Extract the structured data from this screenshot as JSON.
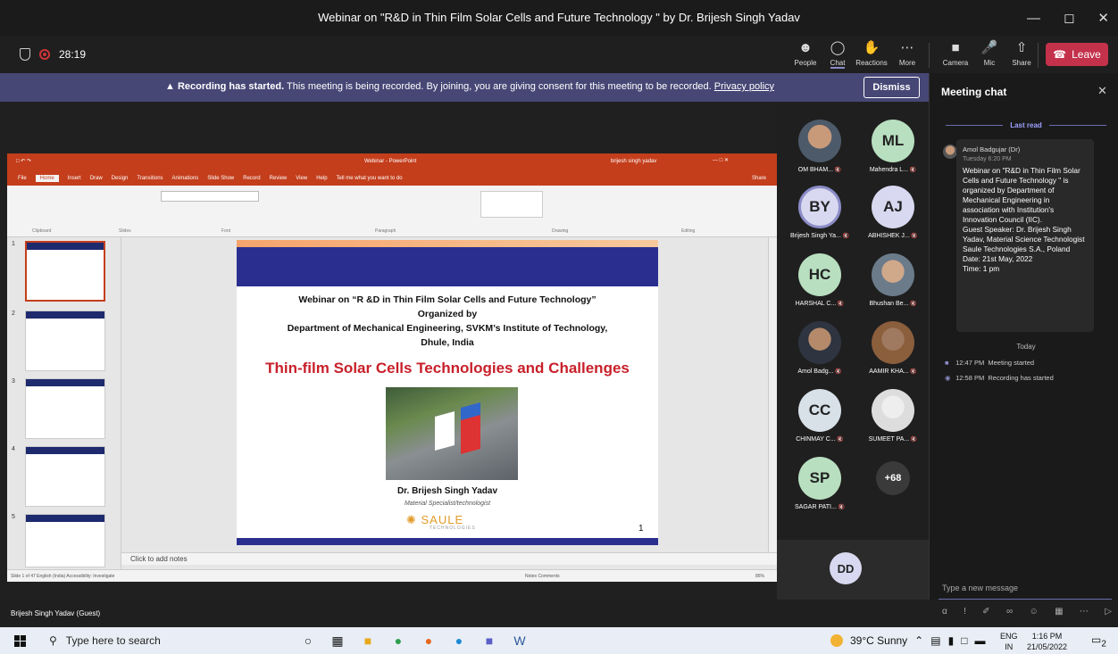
{
  "window": {
    "title": "Webinar on \"R&D in Thin Film Solar Cells and Future Technology \" by Dr. Brijesh Singh Yadav"
  },
  "meeting": {
    "timer": "28:19",
    "controls": [
      {
        "label": "People",
        "icon": "people-icon"
      },
      {
        "label": "Chat",
        "icon": "chat-icon"
      },
      {
        "label": "Reactions",
        "icon": "reactions-icon"
      },
      {
        "label": "More",
        "icon": "more-icon"
      },
      {
        "label": "Camera",
        "icon": "camera-off-icon"
      },
      {
        "label": "Mic",
        "icon": "mic-off-icon"
      },
      {
        "label": "Share",
        "icon": "share-icon"
      }
    ],
    "leave_label": "Leave"
  },
  "banner": {
    "title": "Recording has started.",
    "message": "This meeting is being recorded. By joining, you are giving consent for this meeting to be recorded.",
    "link": "Privacy policy",
    "dismiss": "Dismiss"
  },
  "ppt": {
    "title": "Webinar - PowerPoint",
    "user": "brijesh singh yadav",
    "tabs": [
      "File",
      "Home",
      "Insert",
      "Draw",
      "Design",
      "Transitions",
      "Animations",
      "Slide Show",
      "Record",
      "Review",
      "View",
      "Help",
      "Tell me what you want to do"
    ],
    "share": "Share",
    "groups": [
      "Clipboard",
      "Slides",
      "Font",
      "Paragraph",
      "Drawing",
      "Editing"
    ],
    "notes_placeholder": "Click to add notes",
    "status": "Slide 1 of 47    English (India)    Accessibility: Investigate",
    "status_right": "Notes   Comments",
    "zoom": "86%",
    "slide_numbers": [
      "1",
      "2",
      "3",
      "4",
      "5"
    ]
  },
  "slide": {
    "line1": "Webinar on “R &D in Thin Film Solar Cells and Future Technology”",
    "line2": "Organized by",
    "line3": "Department of Mechanical Engineering, SVKM’s Institute of Technology,",
    "line4": "Dhule, India",
    "headline": "Thin-film Solar Cells Technologies and Challenges",
    "speaker": "Dr. Brijesh Singh Yadav",
    "role": "Material Specialist/technologist",
    "logo": "SAULE",
    "logo_sub": "TECHNOLOGIES",
    "page": "1"
  },
  "participants": [
    {
      "name": "OM BHAM...",
      "initials": "",
      "photo": "ph"
    },
    {
      "name": "Mahendra L...",
      "initials": "ML",
      "bg": "#b8dfc0"
    },
    {
      "name": "Brijesh Singh Ya...",
      "initials": "BY",
      "bg": "#d8d8f0"
    },
    {
      "name": "ABHISHEK J...",
      "initials": "AJ",
      "bg": "#d8d8f0"
    },
    {
      "name": "HARSHAL C...",
      "initials": "HC",
      "bg": "#b8dfc0"
    },
    {
      "name": "Bhushan Be...",
      "initials": "",
      "photo": "ph3"
    },
    {
      "name": "Amol Badg...",
      "initials": "",
      "photo": "ph2"
    },
    {
      "name": "AAMIR KHA...",
      "initials": "",
      "photo": "ph4"
    },
    {
      "name": "CHINMAY C...",
      "initials": "CC",
      "bg": "#d8e0e8"
    },
    {
      "name": "SUMEET PA...",
      "initials": "",
      "photo": "ph5"
    },
    {
      "name": "SAGAR PATI...",
      "initials": "SP",
      "bg": "#b8dfc0"
    },
    {
      "name": "",
      "initials": "+68",
      "bg": "#3a3a3a"
    }
  ],
  "active_tile": {
    "initials": "DD"
  },
  "guest_label": "Brijesh Singh Yadav (Guest)",
  "chat": {
    "title": "Meeting chat",
    "last_read": "Last read",
    "message": {
      "author": "Amol Badgujar (Dr)",
      "time": "Tuesday 6:20 PM",
      "text": "Webinar on \"R&D in Thin Film Solar Cells and Future Technology \" is organized by Department of Mechanical Engineering in association with Institution's Innovation Council (IIC).\nGuest Speaker: Dr. Brijesh Singh Yadav, Material Science Technologist Saule Technologies S.A., Poland\nDate: 21st May, 2022\nTime: 1 pm"
    },
    "today": "Today",
    "events": [
      {
        "time": "12:47 PM",
        "text": "Meeting started"
      },
      {
        "time": "12:58 PM",
        "text": "Recording has started"
      }
    ],
    "compose_placeholder": "Type a new message"
  },
  "taskbar": {
    "search": "Type here to search",
    "weather": "39°C  Sunny",
    "lang1": "ENG",
    "lang2": "IN",
    "time": "1:16 PM",
    "date": "21/05/2022",
    "notif_count": "2"
  }
}
